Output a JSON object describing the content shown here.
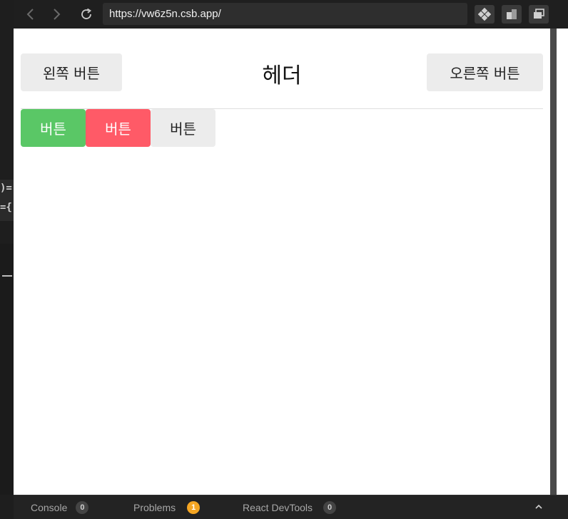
{
  "browser": {
    "url": "https://vw6z5n.csb.app/",
    "back_icon": "chevron-left-icon",
    "forward_icon": "chevron-right-icon",
    "reload_icon": "reload-icon"
  },
  "editor_fragments": [
    ")=",
    "={"
  ],
  "app": {
    "header_title": "헤더",
    "left_button": "왼쪽 버튼",
    "right_button": "오른쪽 버튼",
    "buttons": [
      {
        "label": "버튼",
        "color": "#5ac766"
      },
      {
        "label": "버튼",
        "color": "#ff5a67"
      },
      {
        "label": "버튼",
        "color": "#ececec"
      }
    ]
  },
  "devtools": {
    "tabs": [
      {
        "label": "Console",
        "count": "0"
      },
      {
        "label": "Problems",
        "count": "1",
        "accent": "#f5a623"
      },
      {
        "label": "React DevTools",
        "count": "0"
      }
    ]
  }
}
